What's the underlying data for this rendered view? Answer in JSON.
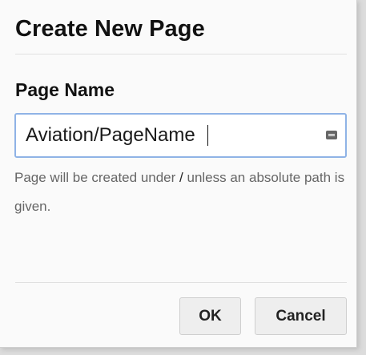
{
  "dialog": {
    "title": "Create New Page",
    "field_label": "Page Name",
    "input_value": "Aviation/PageName",
    "help_before": "Page will be created under ",
    "help_slash": "/",
    "help_after": " unless an absolute path is given.",
    "ok_label": "OK",
    "cancel_label": "Cancel",
    "input_icon": "keyboard-icon",
    "focus_color": "#8fb3e6"
  }
}
